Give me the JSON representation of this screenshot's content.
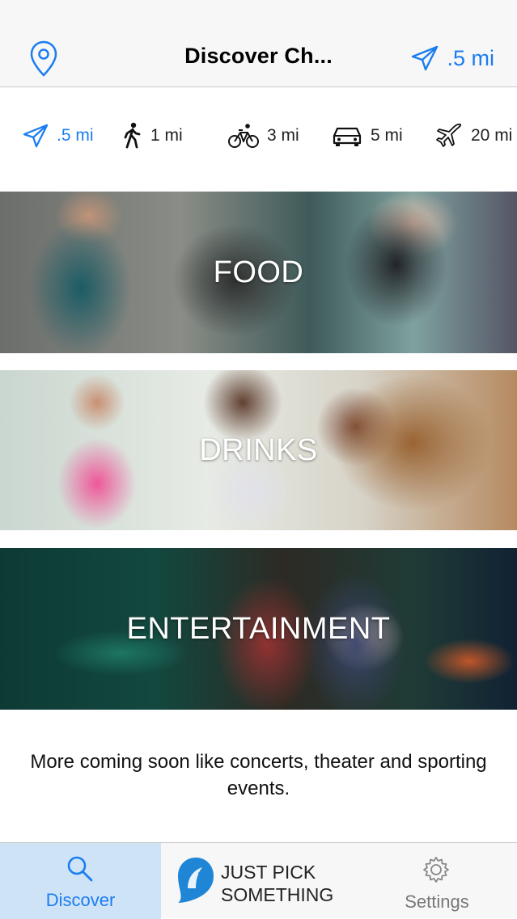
{
  "nav": {
    "title": "Discover Ch...",
    "distance": ".5 mi",
    "location_icon": "location-pin-icon",
    "distance_icon": "paper-plane-icon"
  },
  "distances": [
    {
      "label": ".5 mi",
      "icon": "paper-plane-icon",
      "selected": true
    },
    {
      "label": "1 mi",
      "icon": "walking-icon",
      "selected": false
    },
    {
      "label": "3 mi",
      "icon": "bicycle-icon",
      "selected": false
    },
    {
      "label": "5 mi",
      "icon": "car-icon",
      "selected": false
    },
    {
      "label": "20 mi",
      "icon": "airplane-icon",
      "selected": false
    }
  ],
  "categories": [
    {
      "label": "FOOD"
    },
    {
      "label": "DRINKS"
    },
    {
      "label": "ENTERTAINMENT"
    }
  ],
  "coming_soon": "More coming soon like concerts, theater and sporting events.",
  "tabs": {
    "discover": "Discover",
    "pick_line1": "JUST PICK",
    "pick_line2": "SOMETHING",
    "settings": "Settings"
  },
  "colors": {
    "accent": "#1a7df0",
    "selected_tab_bg": "#cfe3f7",
    "bar_bg": "#f7f7f7"
  }
}
